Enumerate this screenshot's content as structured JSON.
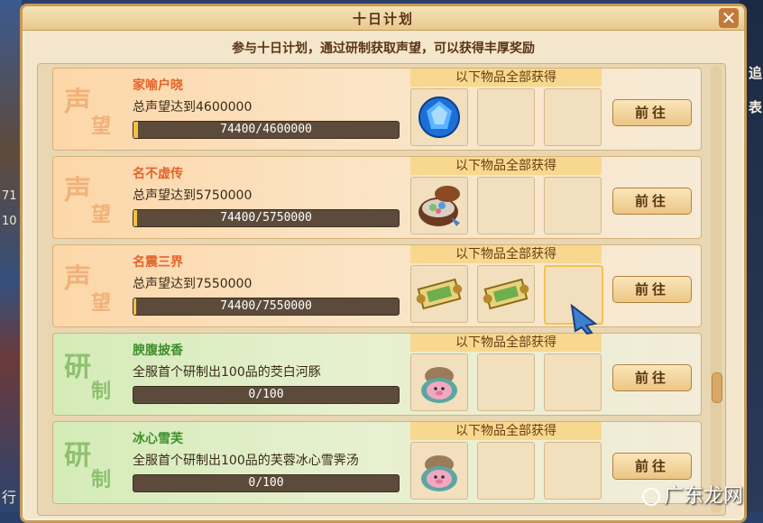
{
  "window": {
    "title": "十日计划",
    "subtitle": "参与十日计划，通过研制获取声望，可以获得丰厚奖励"
  },
  "background": {
    "left_numbers": [
      "71",
      "10"
    ],
    "right_texts": [
      "追",
      "表"
    ],
    "left_bottom_text": "行"
  },
  "watermark": "广东龙网",
  "items": [
    {
      "badge_top": "声",
      "badge_bottom": "望",
      "name": "家喻户晓",
      "desc": "总声望达到4600000",
      "progress_text": "74400/4600000",
      "progress": 0.016,
      "reward_header": "以下物品全部获得",
      "rewards": [
        "blue-gem-icon"
      ],
      "button": "前往"
    },
    {
      "badge_top": "声",
      "badge_bottom": "望",
      "name": "名不虚传",
      "desc": "总声望达到5750000",
      "progress_text": "74400/5750000",
      "progress": 0.013,
      "reward_header": "以下物品全部获得",
      "rewards": [
        "gift-box-icon"
      ],
      "button": "前往"
    },
    {
      "badge_top": "声",
      "badge_bottom": "望",
      "name": "名震三界",
      "desc": "总声望达到7550000",
      "progress_text": "74400/7550000",
      "progress": 0.01,
      "reward_header": "以下物品全部获得",
      "rewards": [
        "scroll-icon",
        "scroll-icon"
      ],
      "button": "前往"
    },
    {
      "badge_top": "研",
      "badge_bottom": "制",
      "name": "腴腹披香",
      "desc": "全服首个研制出100品的茭白河豚",
      "progress_text": "0/100",
      "progress": 0,
      "reward_header": "以下物品全部获得",
      "rewards": [
        "pig-pot-icon"
      ],
      "button": "前往"
    },
    {
      "badge_top": "研",
      "badge_bottom": "制",
      "name": "冰心雪芙",
      "desc": "全服首个研制出100品的芙蓉冰心雪霁汤",
      "progress_text": "0/100",
      "progress": 0,
      "reward_header": "以下物品全部获得",
      "rewards": [
        "pig-pot-icon"
      ],
      "button": "前往"
    }
  ]
}
